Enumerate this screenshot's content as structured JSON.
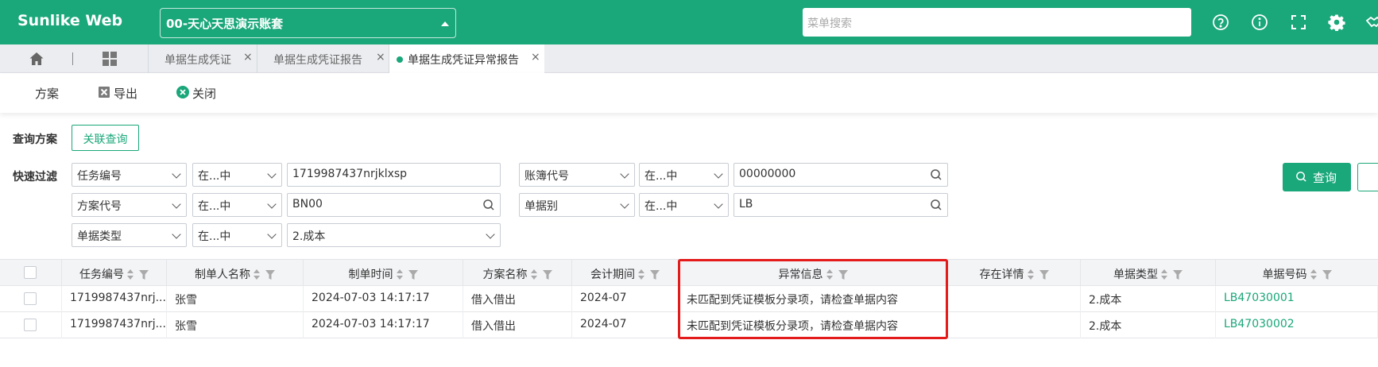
{
  "header": {
    "app_title": "Sunlike Web",
    "account_selector": "00-天心天思演示账套",
    "menu_search_placeholder": "菜单搜索",
    "icons": [
      "help-icon",
      "info-icon",
      "fullscreen-icon",
      "settings-icon",
      "handshake-icon"
    ]
  },
  "tabs": {
    "items": [
      {
        "label": "单据生成凭证",
        "close": "×"
      },
      {
        "label": "单据生成凭证报告",
        "close": "×"
      },
      {
        "label": "单据生成凭证异常报告",
        "close": "×"
      }
    ]
  },
  "toolbar": {
    "scheme_label": "方案",
    "export_label": "导出",
    "close_label": "关闭"
  },
  "query": {
    "scheme_label": "查询方案",
    "linked_query_button": "关联查询",
    "quick_filter_label": "快速过滤",
    "search_button": "查询",
    "rows": [
      [
        {
          "field": "任务编号",
          "op": "在...中",
          "value": "1719987437nrjklxsp"
        },
        {
          "field": "账簿代号",
          "op": "在...中",
          "value": "00000000"
        }
      ],
      [
        {
          "field": "方案代号",
          "op": "在...中",
          "value": "BN00"
        },
        {
          "field": "单据别",
          "op": "在...中",
          "value": "LB"
        }
      ],
      [
        {
          "field": "单据类型",
          "op": "在...中",
          "value": "2.成本"
        }
      ]
    ]
  },
  "table": {
    "columns": [
      "任务编号",
      "制单人名称",
      "制单时间",
      "方案名称",
      "会计期间",
      "异常信息",
      "存在详情",
      "单据类型",
      "单据号码"
    ],
    "rows": [
      [
        "1719987437nrj...",
        "张雪",
        "2024-07-03 14:17:17",
        "借入借出",
        "2024-07",
        "未匹配到凭证模板分录项，请检查单据内容",
        "",
        "2.成本",
        "LB47030001"
      ],
      [
        "1719987437nrj...",
        "张雪",
        "2024-07-03 14:17:17",
        "借入借出",
        "2024-07",
        "未匹配到凭证模板分录项，请检查单据内容",
        "",
        "2.成本",
        "LB47030002"
      ]
    ]
  },
  "colors": {
    "brand": "#1aa77a",
    "highlight": "#e31b1b"
  }
}
